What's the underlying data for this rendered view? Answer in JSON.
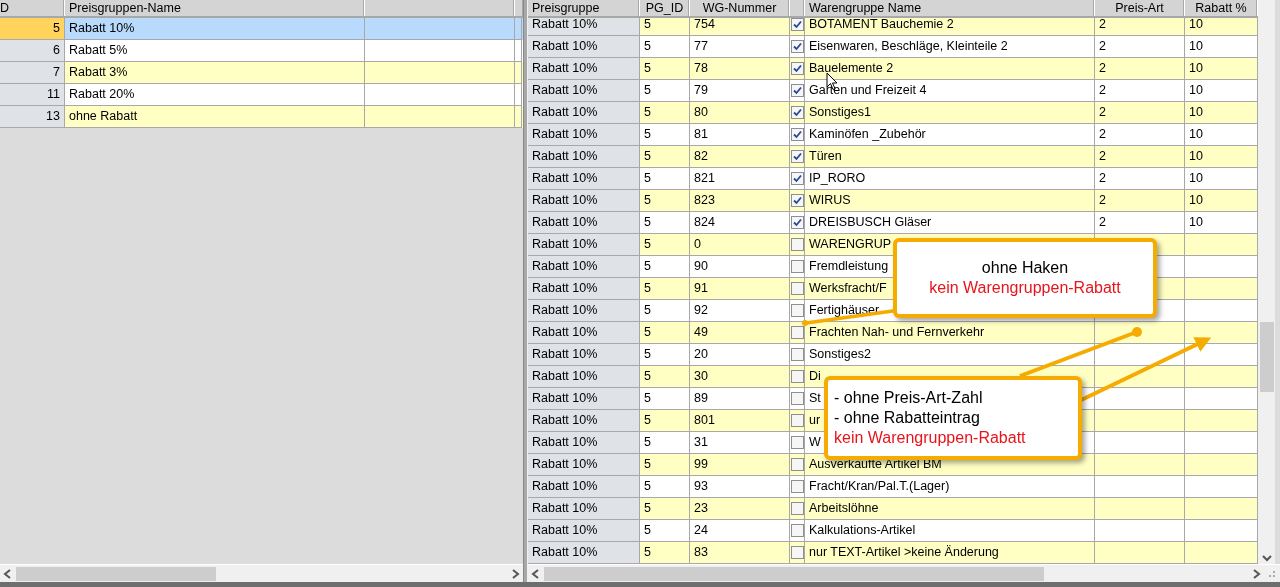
{
  "left_grid": {
    "columns": [
      "D",
      "Preisgruppen-Name"
    ],
    "rows": [
      {
        "id": "5",
        "name": "Rabatt 10%",
        "selected": true
      },
      {
        "id": "6",
        "name": "Rabatt 5%",
        "selected": false
      },
      {
        "id": "7",
        "name": "Rabatt 3%",
        "selected": false
      },
      {
        "id": "11",
        "name": "Rabatt 20%",
        "selected": false
      },
      {
        "id": "13",
        "name": "ohne Rabatt",
        "selected": false
      }
    ]
  },
  "right_grid": {
    "columns": [
      "Preisgruppe",
      "PG_ID",
      "WG-Nummer",
      "Warengruppe Name",
      "Preis-Art",
      "Rabatt %"
    ],
    "rows": [
      {
        "group": "Rabatt 10%",
        "pg_id": "5",
        "wg": "754",
        "checked": true,
        "name": "BOTAMENT Bauchemie 2",
        "art": "2",
        "rabatt": "10"
      },
      {
        "group": "Rabatt 10%",
        "pg_id": "5",
        "wg": "77",
        "checked": true,
        "name": "Eisenwaren, Beschläge, Kleinteile 2",
        "art": "2",
        "rabatt": "10"
      },
      {
        "group": "Rabatt 10%",
        "pg_id": "5",
        "wg": "78",
        "checked": true,
        "name": "Bauelemente 2",
        "art": "2",
        "rabatt": "10"
      },
      {
        "group": "Rabatt 10%",
        "pg_id": "5",
        "wg": "79",
        "checked": true,
        "name": "Garten und Freizeit 4",
        "art": "2",
        "rabatt": "10"
      },
      {
        "group": "Rabatt 10%",
        "pg_id": "5",
        "wg": "80",
        "checked": true,
        "name": "Sonstiges1",
        "art": "2",
        "rabatt": "10"
      },
      {
        "group": "Rabatt 10%",
        "pg_id": "5",
        "wg": "81",
        "checked": true,
        "name": "Kaminöfen _Zubehör",
        "art": "2",
        "rabatt": "10"
      },
      {
        "group": "Rabatt 10%",
        "pg_id": "5",
        "wg": "82",
        "checked": true,
        "name": "Türen",
        "art": "2",
        "rabatt": "10"
      },
      {
        "group": "Rabatt 10%",
        "pg_id": "5",
        "wg": "821",
        "checked": true,
        "name": "IP_RORO",
        "art": "2",
        "rabatt": "10"
      },
      {
        "group": "Rabatt 10%",
        "pg_id": "5",
        "wg": "823",
        "checked": true,
        "name": "WIRUS",
        "art": "2",
        "rabatt": "10"
      },
      {
        "group": "Rabatt 10%",
        "pg_id": "5",
        "wg": "824",
        "checked": true,
        "name": "DREISBUSCH Gläser",
        "art": "2",
        "rabatt": "10"
      },
      {
        "group": "Rabatt 10%",
        "pg_id": "5",
        "wg": "0",
        "checked": false,
        "name": "WARENGRUP"
      },
      {
        "group": "Rabatt 10%",
        "pg_id": "5",
        "wg": "90",
        "checked": false,
        "name": "Fremdleistung"
      },
      {
        "group": "Rabatt 10%",
        "pg_id": "5",
        "wg": "91",
        "checked": false,
        "name": "Werksfracht/F"
      },
      {
        "group": "Rabatt 10%",
        "pg_id": "5",
        "wg": "92",
        "checked": false,
        "name": "Fertighäuser"
      },
      {
        "group": "Rabatt 10%",
        "pg_id": "5",
        "wg": "49",
        "checked": false,
        "name": "Frachten Nah- und Fernverkehr"
      },
      {
        "group": "Rabatt 10%",
        "pg_id": "5",
        "wg": "20",
        "checked": false,
        "name": "Sonstiges2"
      },
      {
        "group": "Rabatt 10%",
        "pg_id": "5",
        "wg": "30",
        "checked": false,
        "name": "Di"
      },
      {
        "group": "Rabatt 10%",
        "pg_id": "5",
        "wg": "89",
        "checked": false,
        "name": "St"
      },
      {
        "group": "Rabatt 10%",
        "pg_id": "5",
        "wg": "801",
        "checked": false,
        "name": "ur"
      },
      {
        "group": "Rabatt 10%",
        "pg_id": "5",
        "wg": "31",
        "checked": false,
        "name": "W"
      },
      {
        "group": "Rabatt 10%",
        "pg_id": "5",
        "wg": "99",
        "checked": false,
        "name": "Ausverkaufte Artikel BM"
      },
      {
        "group": "Rabatt 10%",
        "pg_id": "5",
        "wg": "93",
        "checked": false,
        "name": "Fracht/Kran/Pal.T.(Lager)"
      },
      {
        "group": "Rabatt 10%",
        "pg_id": "5",
        "wg": "23",
        "checked": false,
        "name": "Arbeitslöhne"
      },
      {
        "group": "Rabatt 10%",
        "pg_id": "5",
        "wg": "24",
        "checked": false,
        "name": "Kalkulations-Artikel"
      },
      {
        "group": "Rabatt 10%",
        "pg_id": "5",
        "wg": "83",
        "checked": false,
        "name": "nur TEXT-Artikel >keine Änderung"
      }
    ]
  },
  "callouts": [
    {
      "lines": [
        {
          "text": "ohne Haken",
          "kind": "note"
        },
        {
          "text": "kein Warengruppen-Rabatt",
          "kind": "warning"
        }
      ]
    },
    {
      "lines": [
        {
          "text": "- ohne Preis-Art-Zahl",
          "kind": "note"
        },
        {
          "text": "- ohne Rabatteintrag",
          "kind": "note"
        },
        {
          "text": "kein Warengruppen-Rabatt",
          "kind": "warning"
        }
      ]
    }
  ]
}
